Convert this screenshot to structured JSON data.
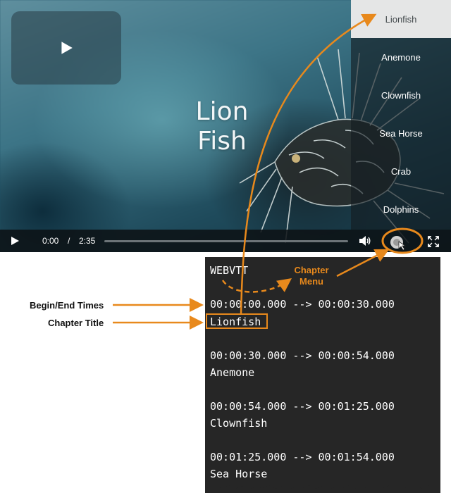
{
  "player": {
    "overlay_title_line1": "Lion",
    "overlay_title_line2": "Fish",
    "chapters": [
      "Lionfish",
      "Anemone",
      "Clownfish",
      "Sea Horse",
      "Crab",
      "Dolphins"
    ],
    "selected_chapter": "Lionfish",
    "controls": {
      "current_time": "0:00",
      "separator": "/",
      "duration": "2:35",
      "progress": 0
    }
  },
  "annotations": {
    "chapter_menu_line1": "Chapter",
    "chapter_menu_line2": "Menu",
    "begin_end_times": "Begin/End Times",
    "chapter_title": "Chapter Title"
  },
  "webvtt": {
    "header": "WEBVTT",
    "cues": [
      {
        "timing": "00:00:00.000 --> 00:00:30.000",
        "title": "Lionfish"
      },
      {
        "timing": "00:00:30.000 --> 00:00:54.000",
        "title": "Anemone"
      },
      {
        "timing": "00:00:54.000 --> 00:01:25.000",
        "title": "Clownfish"
      },
      {
        "timing": "00:01:25.000 --> 00:01:54.000",
        "title": "Sea Horse"
      }
    ]
  },
  "colors": {
    "annotation_orange": "#e8891c",
    "code_background": "#262626",
    "menu_selected": "#e5e6e6"
  },
  "icons": [
    "play-icon",
    "volume-icon",
    "chapters-icon",
    "fullscreen-icon",
    "cursor-hand-icon"
  ]
}
